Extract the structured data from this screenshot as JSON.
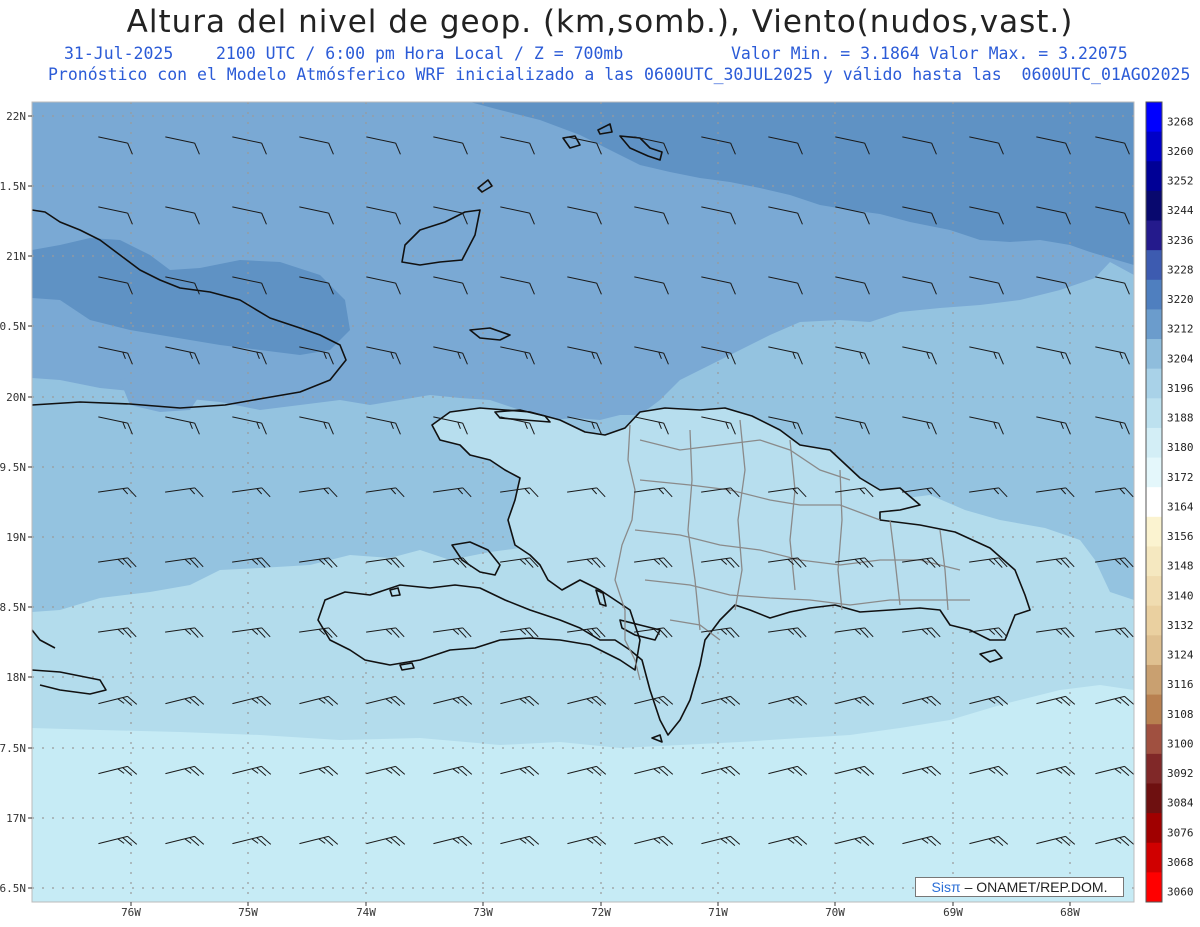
{
  "header": {
    "title": "Altura del nivel de geop. (km,somb.), Viento(nudos,vast.)",
    "date": "31-Jul-2025",
    "time": "2100 UTC / 6:00 pm Hora Local / Z = 700mb",
    "min_label": "Valor Min. = 3.1864",
    "max_label": "Valor Max. = 3.22075",
    "forecast": "Pronóstico con el Modelo Atmósferico WRF inicializado a las 0600UTC_30JUL2025 y válido hasta las  0600UTC_01AGO2025"
  },
  "axes": {
    "lat_labels": [
      "22N",
      "1.5N",
      "21N",
      "0.5N",
      "20N",
      "9.5N",
      "19N",
      "8.5N",
      "18N",
      "7.5N",
      "17N",
      "6.5N"
    ],
    "lon_labels": [
      "76W",
      "75W",
      "74W",
      "73W",
      "72W",
      "71W",
      "70W",
      "69W",
      "68W"
    ]
  },
  "colorbar": {
    "levels": [
      "3268",
      "3260",
      "3252",
      "3244",
      "3236",
      "3228",
      "3220",
      "3212",
      "3204",
      "3196",
      "3188",
      "3180",
      "3172",
      "3164",
      "3156",
      "3148",
      "3140",
      "3132",
      "3124",
      "3116",
      "3108",
      "3100",
      "3092",
      "3084",
      "3076",
      "3068",
      "3060"
    ],
    "colors": [
      "#0000ff",
      "#0000c8",
      "#000096",
      "#08086e",
      "#241a8c",
      "#3d5bb0",
      "#4f7fbf",
      "#6b9ccc",
      "#8fbddc",
      "#a9d2e8",
      "#bde1ef",
      "#d3eef6",
      "#e4f7fb",
      "#ffffff",
      "#fbf3d0",
      "#f5e8c0",
      "#f0dcb0",
      "#ead0a0",
      "#dfc090",
      "#c9a070",
      "#b88050",
      "#a05040",
      "#802828",
      "#6e1010",
      "#a00000",
      "#d00000",
      "#ff0000"
    ]
  },
  "regions": {
    "colors": {
      "z3220": "#5e91c4",
      "z3212": "#79a8d4",
      "z3204": "#93c2e0",
      "z3196": "#b2dcec",
      "z3188": "#c8ecf5"
    }
  },
  "footer": {
    "logo": "Sisπ",
    "text": "– ONAMET/REP.DOM."
  }
}
